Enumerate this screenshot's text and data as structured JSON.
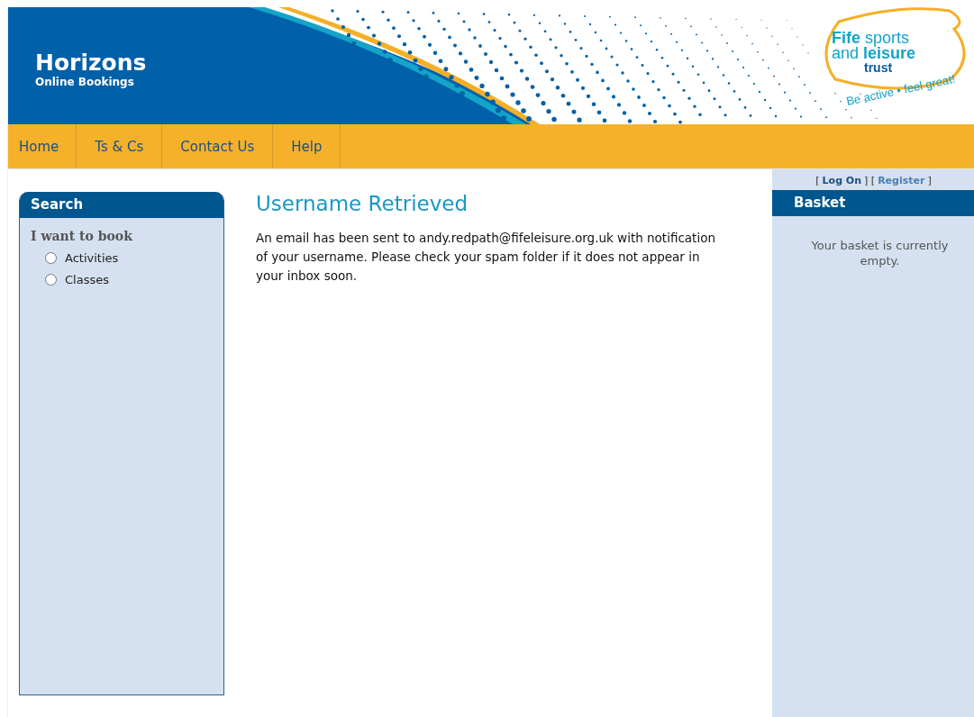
{
  "header": {
    "title": "Horizons",
    "subtitle": "Online Bookings",
    "logo": {
      "line_1_bold": "Fife",
      "line_1": "sports",
      "line_2": "and",
      "line_2_bold": "leisure",
      "line_3": "trust",
      "tagline": "Be active • feel great!"
    }
  },
  "nav": [
    {
      "label": "Home"
    },
    {
      "label": "Ts & Cs"
    },
    {
      "label": "Contact Us"
    },
    {
      "label": "Help"
    }
  ],
  "search": {
    "title": "Search",
    "prompt": "I want to book",
    "options": [
      {
        "label": "Activities",
        "selected": false
      },
      {
        "label": "Classes",
        "selected": false
      }
    ]
  },
  "main": {
    "heading": "Username Retrieved",
    "message": "An email has been sent to andy.redpath@fifeleisure.org.uk with notification of your username. Please check your spam folder if it does not appear in your inbox soon."
  },
  "account": {
    "open": "[",
    "log_on": "Log On",
    "mid": "] [",
    "register": "Register",
    "close": "]"
  },
  "basket": {
    "title": "Basket",
    "message": "Your basket is currently empty."
  }
}
